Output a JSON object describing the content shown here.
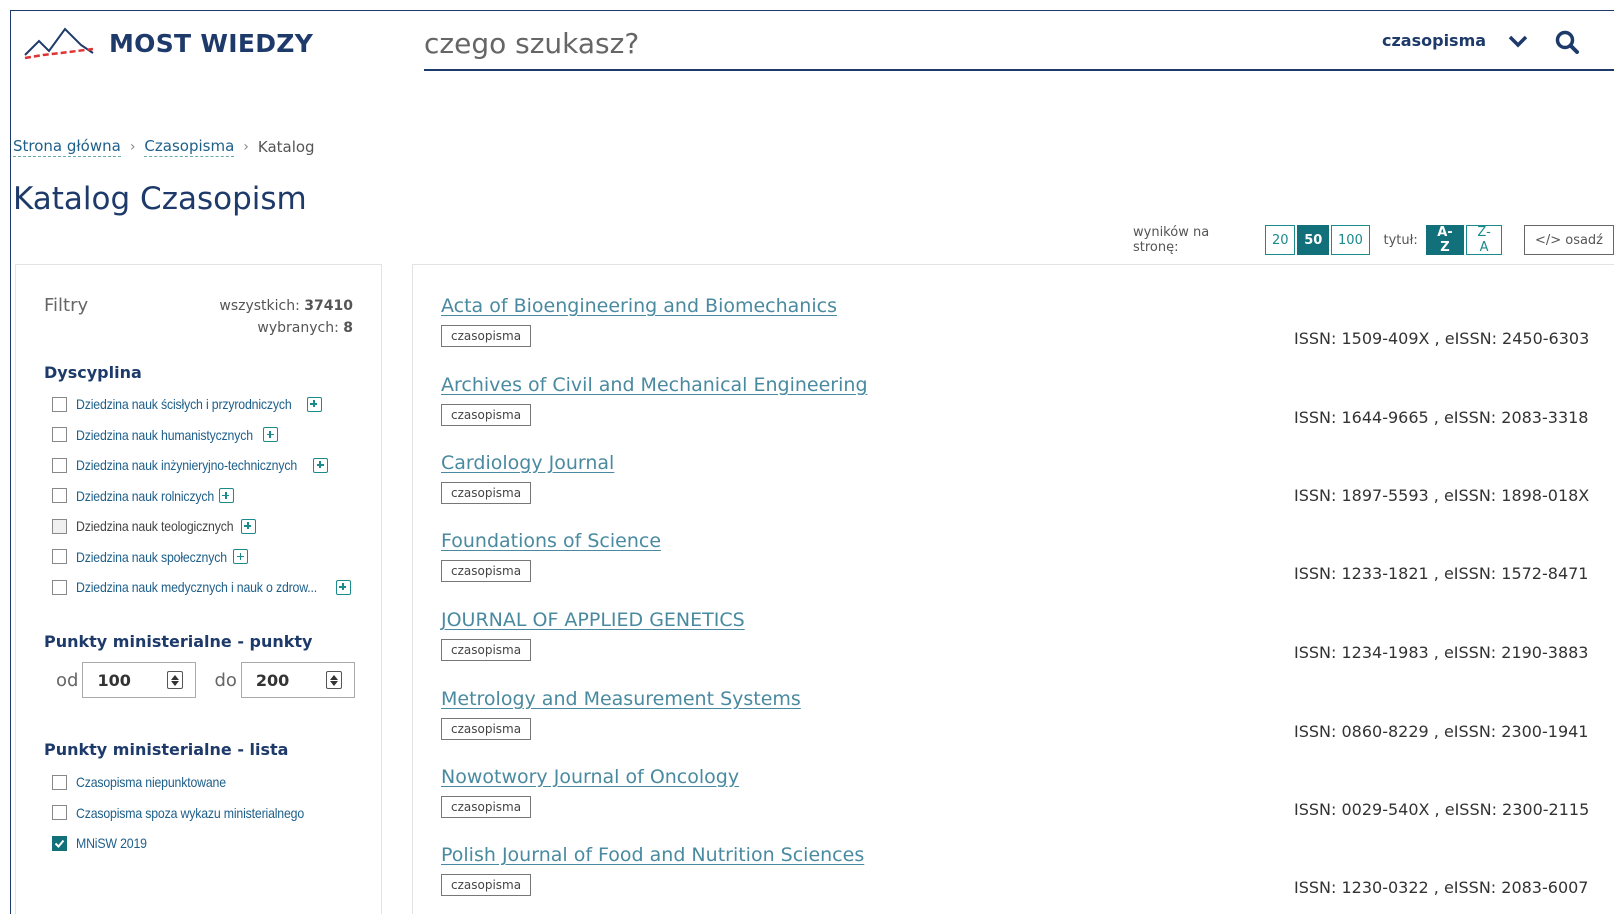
{
  "header": {
    "logo_text": "MOST WIEDZY",
    "search_placeholder": "czego szukasz?",
    "scope": "czasopisma"
  },
  "breadcrumb": {
    "home": "Strona główna",
    "section": "Czasopisma",
    "current": "Katalog",
    "separator": "›"
  },
  "page_title": "Katalog Czasopism",
  "toolbar": {
    "per_page_label": "wyników na stronę:",
    "per_page_options": [
      "20",
      "50",
      "100"
    ],
    "per_page_selected": "50",
    "sort_label": "tytuł:",
    "sort_options": [
      "A-Z",
      "Z-A"
    ],
    "sort_selected": "A-Z",
    "embed_label": "</> osadź"
  },
  "filters": {
    "title": "Filtry",
    "total_label": "wszystkich:",
    "total": "37410",
    "selected_label": "wybranych:",
    "selected": "8",
    "discipline": {
      "title": "Dyscyplina",
      "items": [
        {
          "label": "Dziedzina nauk ścisłych i przyrodniczych",
          "checked": false
        },
        {
          "label": "Dziedzina nauk humanistycznych",
          "checked": false
        },
        {
          "label": "Dziedzina nauk inżynieryjno-technicznych",
          "checked": false
        },
        {
          "label": "Dziedzina nauk rolniczych",
          "checked": false
        },
        {
          "label": "Dziedzina nauk teologicznych",
          "checked": false
        },
        {
          "label": "Dziedzina nauk społecznych",
          "checked": false
        },
        {
          "label": "Dziedzina nauk medycznych i nauk o zdrow...",
          "checked": false
        }
      ]
    },
    "points": {
      "title": "Punkty ministerialne - punkty",
      "from_label": "od",
      "from_value": "100",
      "to_label": "do",
      "to_value": "200"
    },
    "list": {
      "title": "Punkty ministerialne - lista",
      "items": [
        {
          "label": "Czasopisma niepunktowane",
          "checked": false
        },
        {
          "label": "Czasopisma spoza wykazu ministerialnego",
          "checked": false
        },
        {
          "label": "MNiSW 2019",
          "checked": true
        }
      ]
    }
  },
  "results": [
    {
      "title": "Acta of Bioengineering and Biomechanics",
      "tag": "czasopisma",
      "issn": "ISSN: 1509-409X , eISSN: 2450-6303"
    },
    {
      "title": "Archives of Civil and Mechanical Engineering",
      "tag": "czasopisma",
      "issn": "ISSN: 1644-9665 , eISSN: 2083-3318"
    },
    {
      "title": "Cardiology Journal",
      "tag": "czasopisma",
      "issn": "ISSN: 1897-5593 , eISSN: 1898-018X"
    },
    {
      "title": "Foundations of Science",
      "tag": "czasopisma",
      "issn": "ISSN: 1233-1821 , eISSN: 1572-8471"
    },
    {
      "title": "JOURNAL OF APPLIED GENETICS",
      "tag": "czasopisma",
      "issn": "ISSN: 1234-1983 , eISSN: 2190-3883"
    },
    {
      "title": "Metrology and Measurement Systems",
      "tag": "czasopisma",
      "issn": "ISSN: 0860-8229 , eISSN: 2300-1941"
    },
    {
      "title": "Nowotwory Journal of Oncology",
      "tag": "czasopisma",
      "issn": "ISSN: 0029-540X , eISSN: 2300-2115"
    },
    {
      "title": "Polish Journal of Food and Nutrition Sciences",
      "tag": "czasopisma",
      "issn": "ISSN: 1230-0322 , eISSN: 2083-6007"
    }
  ]
}
